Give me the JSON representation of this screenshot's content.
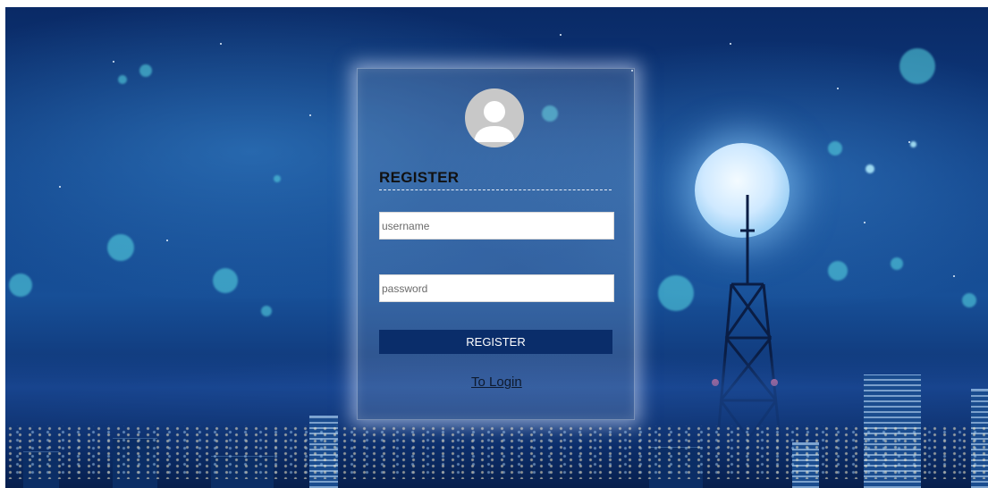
{
  "form": {
    "title": "REGISTER",
    "username_placeholder": "username",
    "password_placeholder": "password",
    "submit_label": "REGISTER",
    "login_link": "To Login"
  },
  "icons": {
    "avatar": "user-avatar-icon"
  },
  "colors": {
    "button_bg": "#0a2d6a",
    "avatar_bg": "#c8c8c8"
  }
}
